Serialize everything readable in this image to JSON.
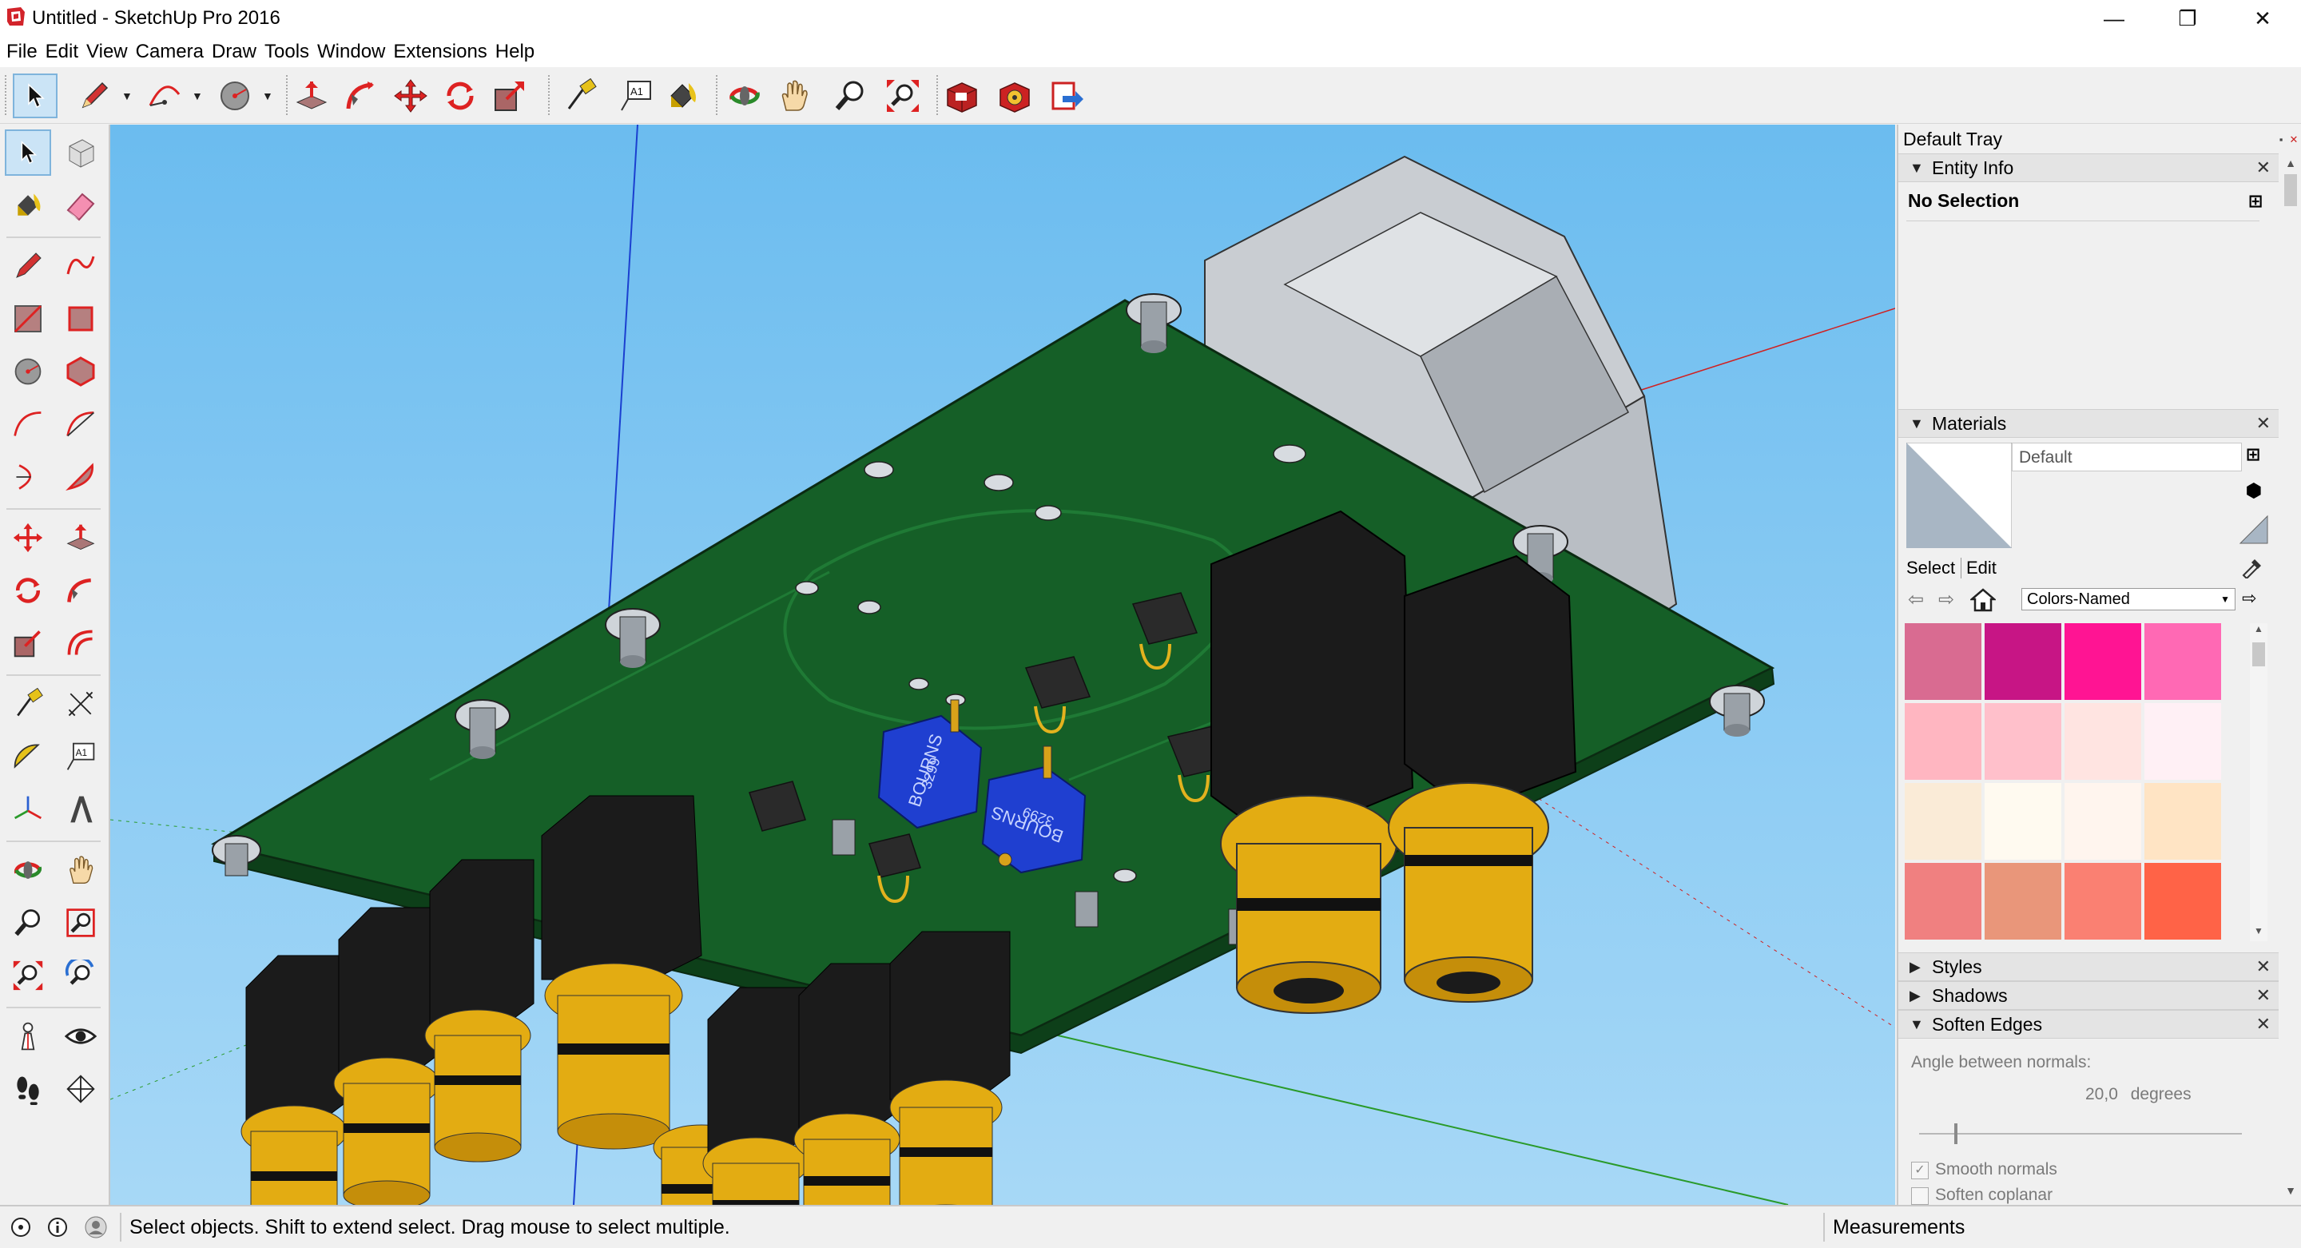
{
  "window": {
    "title": "Untitled - SketchUp Pro 2016",
    "minimize_glyph": "—",
    "maximize_glyph": "❐",
    "close_glyph": "✕"
  },
  "menu": [
    "File",
    "Edit",
    "View",
    "Camera",
    "Draw",
    "Tools",
    "Window",
    "Extensions",
    "Help"
  ],
  "top_toolbar": {
    "tools": [
      "select-icon",
      "pencil-line-icon",
      "arc-icon",
      "circle-icon",
      "push-pull-icon",
      "follow-me-icon",
      "move-icon",
      "rotate-icon",
      "scale-icon",
      "tape-measure-icon",
      "text-icon",
      "paint-bucket-icon",
      "orbit-icon",
      "pan-icon",
      "zoom-icon",
      "zoom-extents-icon",
      "3d-warehouse-icon",
      "extension-warehouse-icon",
      "layout-send-icon"
    ],
    "text_tool_label": "A1"
  },
  "left_toolbar": {
    "tools": [
      "select-icon",
      "make-component-icon",
      "paint-bucket-icon",
      "eraser-icon",
      "pencil-line-icon",
      "freehand-icon",
      "rectangle-icon",
      "rotated-rectangle-icon",
      "circle-icon",
      "polygon-icon",
      "arc-icon",
      "two-point-arc-icon",
      "three-point-arc-icon",
      "pie-icon",
      "move-icon",
      "push-pull-icon",
      "rotate-icon",
      "follow-me-icon",
      "scale-icon",
      "offset-icon",
      "tape-measure-icon",
      "dimension-icon",
      "protractor-icon",
      "text-icon",
      "axes-icon",
      "3d-text-icon",
      "orbit-icon",
      "pan-icon",
      "zoom-icon",
      "zoom-window-icon",
      "zoom-extents-icon",
      "previous-view-icon",
      "position-camera-icon",
      "look-around-icon",
      "walk-icon",
      "section-plane-icon"
    ],
    "text_tool_label": "A1"
  },
  "model": {
    "pot_label": "BOURNS",
    "pot_code": "3299"
  },
  "tray": {
    "title": "Default Tray",
    "entity_info": {
      "header": "Entity Info",
      "selection": "No Selection"
    },
    "materials": {
      "header": "Materials",
      "current_material": "Default",
      "tab_select": "Select",
      "tab_edit": "Edit",
      "library": "Colors-Named",
      "swatches": [
        "#d96b91",
        "#c71585",
        "#ff1493",
        "#ff69b4",
        "#ffb6c1",
        "#ffc0cb",
        "#ffe4e1",
        "#fff0f5",
        "#faebd7",
        "#fffaf0",
        "#fff5ee",
        "#ffe4c4",
        "#f08080",
        "#e9967a",
        "#fa8072",
        "#ff6347"
      ]
    },
    "styles": {
      "header": "Styles"
    },
    "shadows": {
      "header": "Shadows"
    },
    "soften_edges": {
      "header": "Soften Edges",
      "angle_label": "Angle between normals:",
      "angle_value": "20,0",
      "angle_unit": "degrees",
      "smooth_normals": "Smooth normals",
      "soften_coplanar": "Soften coplanar",
      "smooth_normals_checked": true,
      "soften_coplanar_checked": false,
      "slider_fraction": 0.11
    }
  },
  "status": {
    "text": "Select objects. Shift to extend select. Drag mouse to select multiple.",
    "measurements_label": "Measurements"
  }
}
